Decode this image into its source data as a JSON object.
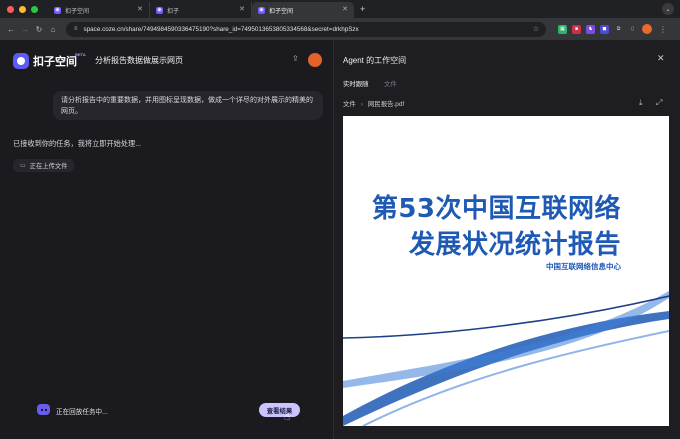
{
  "browser": {
    "tabs": [
      {
        "title": "扣子空间",
        "active": false
      },
      {
        "title": "扣子",
        "active": false
      },
      {
        "title": "扣子空间",
        "active": true
      }
    ],
    "url": "space.coze.cn/share/7494984590336475190?share_id=7495013653805334568&secret=drkhpSzx"
  },
  "app": {
    "brand": "扣子空间",
    "beta": "BETA",
    "chat_title": "分析报告数据做展示网页"
  },
  "chat": {
    "user_message": "请分析报告中的重要数据，并用图标呈现数据，做成一个详尽的对外展示的精美的网页。",
    "assistant_status": "已接收到你的任务，我将立即开始处理...",
    "upload_chip": "正在上传文件",
    "replay_text": "正在回放任务中...",
    "view_result": "查看结果"
  },
  "workspace": {
    "title": "Agent 的工作空间",
    "tabs": {
      "live": "实时跟随",
      "files": "文件"
    },
    "breadcrumb_root": "文件",
    "breadcrumb_file": "网民报告.pdf"
  },
  "pdf": {
    "title_line1": "第53次中国互联网络",
    "title_line2": "发展状况统计报告",
    "org": "中国互联网络信息中心"
  },
  "colors": {
    "accent": "#5b5cf6",
    "view_button": "#c9c6ff",
    "pdf_blue": "#1e5ab4"
  }
}
